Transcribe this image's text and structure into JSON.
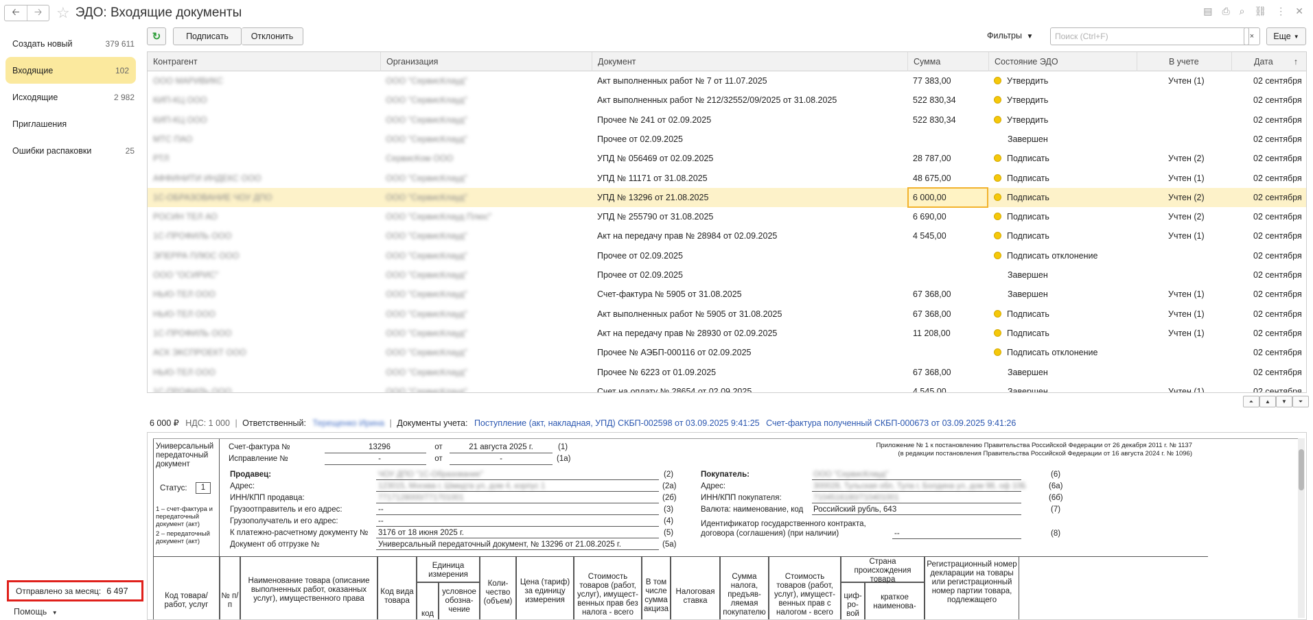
{
  "window": {
    "title": "ЭДО: Входящие документы"
  },
  "sidebar": {
    "items": [
      {
        "label": "Создать новый",
        "count": "379 611"
      },
      {
        "label": "Входящие",
        "count": "102"
      },
      {
        "label": "Исходящие",
        "count": "2 982"
      },
      {
        "label": "Приглашения",
        "count": ""
      },
      {
        "label": "Ошибки распаковки",
        "count": "25"
      }
    ],
    "sent_label": "Отправлено за месяц:",
    "sent_value": "6 497",
    "help_label": "Помощь"
  },
  "toolbar": {
    "sign_label": "Подписать",
    "reject_label": "Отклонить",
    "filters_label": "Фильтры",
    "search_placeholder": "Поиск (Ctrl+F)",
    "clear_label": "×",
    "more_label": "Еще"
  },
  "table": {
    "columns": [
      "Контрагент",
      "Организация",
      "Документ",
      "Сумма",
      "Состояние ЭДО",
      "В учете",
      "Дата"
    ],
    "rows": [
      {
        "counterparty": "ООО МАРИВИКС",
        "org": "ООО \"СервисКлауд\"",
        "doc": "Акт выполненных работ № 7 от 11.07.2025",
        "sum": "77 383,00",
        "state": "Утвердить",
        "dot": true,
        "account": "Учтен (1)",
        "date": "02 сентября"
      },
      {
        "counterparty": "КИП-КЦ ООО",
        "org": "ООО \"СервисКлауд\"",
        "doc": "Акт выполненных работ № 212/32552/09/2025 от 31.08.2025",
        "sum": "522 830,34",
        "state": "Утвердить",
        "dot": true,
        "account": "",
        "date": "02 сентября"
      },
      {
        "counterparty": "КИП-КЦ ООО",
        "org": "ООО \"СервисКлауд\"",
        "doc": "Прочее № 241 от 02.09.2025",
        "sum": "522 830,34",
        "state": "Утвердить",
        "dot": true,
        "account": "",
        "date": "02 сентября"
      },
      {
        "counterparty": "МТС ПАО",
        "org": "ООО \"СервисКлауд\"",
        "doc": "Прочее от 02.09.2025",
        "sum": "",
        "state": "Завершен",
        "dot": false,
        "account": "",
        "date": "02 сентября"
      },
      {
        "counterparty": "РТЛ",
        "org": "СервисКом ООО",
        "doc": "УПД № 056469 от 02.09.2025",
        "sum": "28 787,00",
        "state": "Подписать",
        "dot": true,
        "account": "Учтен (2)",
        "date": "02 сентября"
      },
      {
        "counterparty": "АФФИНИТИ ИНДЕКС ООО",
        "org": "ООО \"СервисКлауд\"",
        "doc": "УПД № 11171 от 31.08.2025",
        "sum": "48 675,00",
        "state": "Подписать",
        "dot": true,
        "account": "Учтен (1)",
        "date": "02 сентября"
      },
      {
        "counterparty": "1С-ОБРАЗОВАНИЕ ЧОУ ДПО",
        "org": "ООО \"СервисКлауд\"",
        "doc": "УПД № 13296 от 21.08.2025",
        "sum": "6 000,00",
        "state": "Подписать",
        "dot": true,
        "account": "Учтен (2)",
        "date": "02 сентября",
        "selected": true
      },
      {
        "counterparty": "РОСИН ТЕЛ АО",
        "org": "ООО \"СервисКлауд Плюс\"",
        "doc": "УПД № 255790 от 31.08.2025",
        "sum": "6 690,00",
        "state": "Подписать",
        "dot": true,
        "account": "Учтен (2)",
        "date": "02 сентября"
      },
      {
        "counterparty": "1С-ПРОФИЛЬ ООО",
        "org": "ООО \"СервисКлауд\"",
        "doc": "Акт на передачу прав № 28984 от 02.09.2025",
        "sum": "4 545,00",
        "state": "Подписать",
        "dot": true,
        "account": "Учтен (1)",
        "date": "02 сентября"
      },
      {
        "counterparty": "ЭПЕРРА ПЛЮС ООО",
        "org": "ООО \"СервисКлауд\"",
        "doc": "Прочее от 02.09.2025",
        "sum": "",
        "state": "Подписать отклонение",
        "dot": true,
        "account": "",
        "date": "02 сентября"
      },
      {
        "counterparty": "ООО \"ОСИРИС\"",
        "org": "ООО \"СервисКлауд\"",
        "doc": "Прочее от 02.09.2025",
        "sum": "",
        "state": "Завершен",
        "dot": false,
        "account": "",
        "date": "02 сентября"
      },
      {
        "counterparty": "НЬЮ-ТЕЛ ООО",
        "org": "ООО \"СервисКлауд\"",
        "doc": "Счет-фактура № 5905 от 31.08.2025",
        "sum": "67 368,00",
        "state": "Завершен",
        "dot": false,
        "account": "Учтен (1)",
        "date": "02 сентября"
      },
      {
        "counterparty": "НЬЮ-ТЕЛ ООО",
        "org": "ООО \"СервисКлауд\"",
        "doc": "Акт выполненных работ № 5905 от 31.08.2025",
        "sum": "67 368,00",
        "state": "Подписать",
        "dot": true,
        "account": "Учтен (1)",
        "date": "02 сентября"
      },
      {
        "counterparty": "1С-ПРОФИЛЬ ООО",
        "org": "ООО \"СервисКлауд\"",
        "doc": "Акт на передачу прав № 28930 от 02.09.2025",
        "sum": "11 208,00",
        "state": "Подписать",
        "dot": true,
        "account": "Учтен (1)",
        "date": "02 сентября"
      },
      {
        "counterparty": "АСК ЭКСПРОЕКТ ООО",
        "org": "ООО \"СервисКлауд\"",
        "doc": "Прочее № АЭБП-000116 от 02.09.2025",
        "sum": "",
        "state": "Подписать отклонение",
        "dot": true,
        "account": "",
        "date": "02 сентября"
      },
      {
        "counterparty": "НЬЮ-ТЕЛ ООО",
        "org": "ООО \"СервисКлауд\"",
        "doc": "Прочее № 6223 от 01.09.2025",
        "sum": "67 368,00",
        "state": "Завершен",
        "dot": false,
        "account": "",
        "date": "02 сентября"
      },
      {
        "counterparty": "1С-ПРОФИЛЬ ООО",
        "org": "ООО \"СервисКлауд\"",
        "doc": "Счет на оплату № 28654 от 02.09.2025",
        "sum": "4 545,00",
        "state": "Завершен",
        "dot": false,
        "account": "Учтен (1)",
        "date": "02 сентября"
      }
    ]
  },
  "info": {
    "sum": "6 000 ₽",
    "vat": "НДС: 1 000",
    "responsible_label": "Ответственный:",
    "responsible_value": "Терещенко Ирина",
    "docs_label": "Документы учета:",
    "link1": "Поступление (акт, накладная, УПД) СКБП-002598 от 03.09.2025 9:41:25",
    "link2": "Счет-фактура полученный СКБП-000673 от 03.09.2025 9:41:26"
  },
  "doc": {
    "upd_title": "Универсальный передаточный документ",
    "status_label": "Статус:",
    "status_value": "1",
    "status_note1": "1 – счет-фактура и передаточный документ (акт)",
    "status_note2": "2 – передаточный документ (акт)",
    "invoice_label": "Счет-фактура №",
    "invoice_no": "13296",
    "from_label": "от",
    "invoice_date": "21 августа 2025 г.",
    "n1": "(1)",
    "correction_label": "Исправление №",
    "correction_no": "-",
    "correction_date": "-",
    "n1a": "(1а)",
    "appendix1": "Приложение № 1 к постановлению Правительства Российской Федерации от 26 декабря 2011 г. № 1137",
    "appendix2": "(в редакции постановления Правительства Российской Федерации от 16 августа 2024 г. № 1096)",
    "seller_label": "Продавец:",
    "seller_value": "ЧОУ ДПО \"1С-Образование\"",
    "n2": "(2)",
    "address_label": "Адрес:",
    "seller_address": "123015, Москва г, Шмидта ул, дом 4, корпус 1",
    "n2a": "(2а)",
    "inn_seller_label": "ИНН/КПП продавца:",
    "inn_seller": "7717128000/771701001",
    "n2b": "(2б)",
    "shipper_label": "Грузоотправитель и его адрес:",
    "shipper_value": "--",
    "n3": "(3)",
    "consignee_label": "Грузополучатель и его адрес:",
    "consignee_value": "--",
    "n4": "(4)",
    "payment_label": "К платежно-расчетному документу №",
    "payment_value": "3176 от 18 июня 2025 г.",
    "n5": "(5)",
    "shipment_label": "Документ об отгрузке №",
    "shipment_value": "Универсальный передаточный документ, № 13296 от 21.08.2025 г.",
    "n5a": "(5а)",
    "buyer_label": "Покупатель:",
    "buyer_value": "ООО \"СервисКлауд\"",
    "n6": "(6)",
    "buyer_address": "300028, Тульская обл, Тула г, Болдина ул, дом 98, оф 10Б",
    "n6a": "(6а)",
    "inn_buyer_label": "ИНН/КПП покупателя:",
    "inn_buyer": "7104516180/710401001",
    "n6b": "(6б)",
    "currency_label": "Валюта: наименование, код",
    "currency_value": "Российский рубль, 643",
    "n7": "(7)",
    "contract_label1": "Идентификатор государственного контракта,",
    "contract_label2": "договора (соглашения) (при наличии)",
    "contract_value": "--",
    "n8": "(8)",
    "cols": {
      "code": "Код товара/ работ, услуг",
      "num": "№ п/п",
      "name": "Наименование товара (описание выполненных работ, оказанных услуг), имущественного права",
      "kind": "Код вида товара",
      "unit": "Единица измерения",
      "unit_code": "код",
      "unit_name": "условное обозна-чение",
      "qty": "Коли-чество (объем)",
      "price": "Цена (тариф) за единицу измерения",
      "cost": "Стоимость товаров (работ, услуг), имущест-венных прав без налога - всего",
      "excise": "В том числе сумма акциза",
      "rate": "Налоговая ставка",
      "tax": "Сумма налога, предъяв-ляемая покупателю",
      "total": "Стоимость товаров (работ, услуг), имущест-венных прав с налогом - всего",
      "country": "Страна происхождения товара",
      "country_code": "циф-ро-вой",
      "country_name": "краткое наименова-",
      "reg": "Регистрационный номер декларации на товары или регистрационный номер партии товара, подлежащего"
    }
  }
}
